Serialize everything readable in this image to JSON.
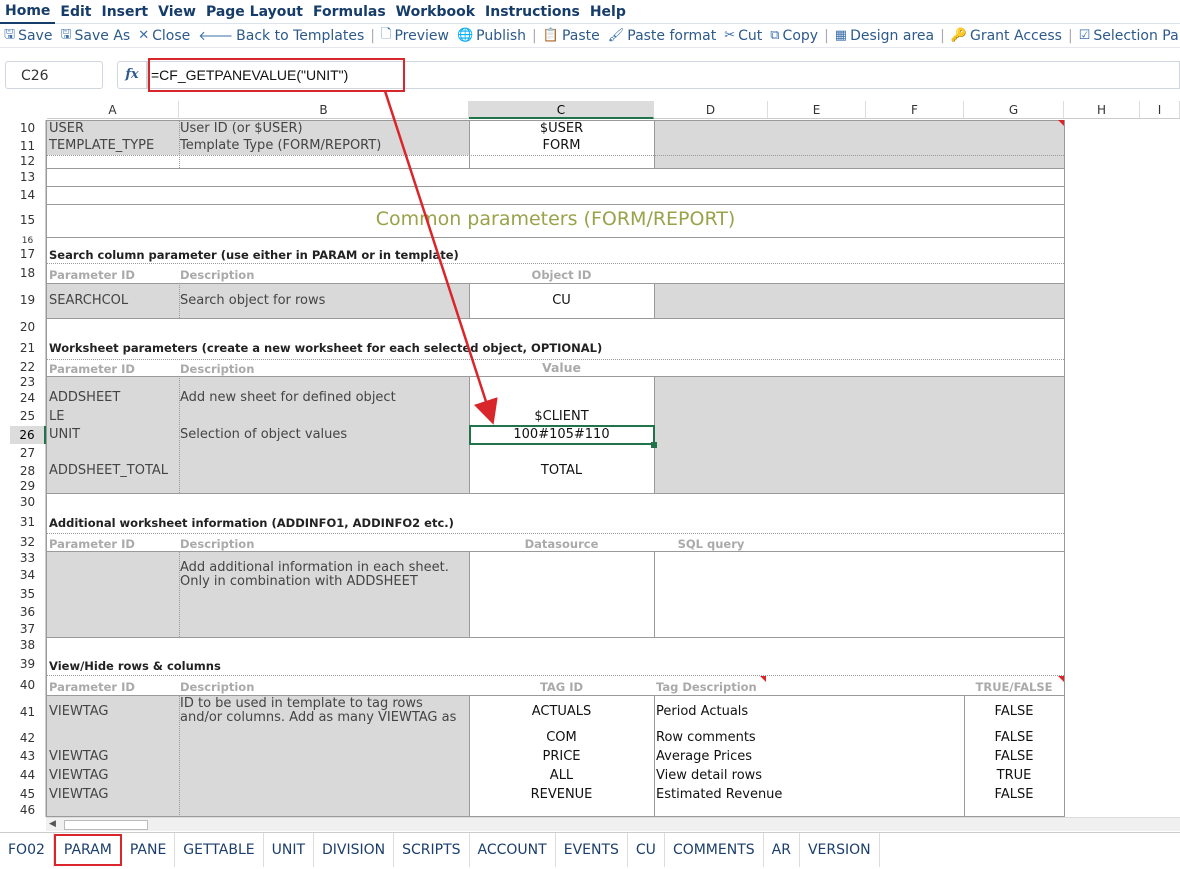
{
  "menu": [
    "Home",
    "Edit",
    "Insert",
    "View",
    "Page Layout",
    "Formulas",
    "Workbook",
    "Instructions",
    "Help"
  ],
  "toolbar": [
    {
      "icon": "save-icon",
      "glyph": "🖫",
      "label": "Save"
    },
    {
      "icon": "save-as-icon",
      "glyph": "🖫",
      "label": "Save As"
    },
    {
      "icon": "close-icon",
      "glyph": "✕",
      "label": "Close"
    },
    {
      "icon": "back-arrow-icon",
      "glyph": "🡐",
      "label": "Back to Templates"
    },
    {
      "sep": true
    },
    {
      "icon": "preview-icon",
      "glyph": "🗋",
      "label": "Preview"
    },
    {
      "icon": "globe-icon",
      "glyph": "🌐",
      "label": "Publish"
    },
    {
      "sep": true
    },
    {
      "icon": "paste-icon",
      "glyph": "📋",
      "label": "Paste"
    },
    {
      "icon": "paste-format-icon",
      "glyph": "🖌",
      "label": "Paste format"
    },
    {
      "icon": "cut-icon",
      "glyph": "✂",
      "label": "Cut"
    },
    {
      "icon": "copy-icon",
      "glyph": "⧉",
      "label": "Copy"
    },
    {
      "sep": true
    },
    {
      "icon": "design-area-icon",
      "glyph": "▦",
      "label": "Design area"
    },
    {
      "sep": true
    },
    {
      "icon": "key-icon",
      "glyph": "🔑",
      "label": "Grant Access"
    },
    {
      "sep": true
    },
    {
      "icon": "selection-pane-icon",
      "glyph": "☑",
      "label": "Selection Pa"
    }
  ],
  "formula_bar": {
    "cell_ref": "C26",
    "fx": "fx",
    "formula": "=CF_GETPANEVALUE(\"UNIT\")"
  },
  "columns": [
    "A",
    "B",
    "C",
    "D",
    "E",
    "F",
    "G",
    "H",
    "I"
  ],
  "rows": [
    "10",
    "11",
    "12",
    "13",
    "14",
    "15",
    "16",
    "17",
    "18",
    "19",
    "20",
    "21",
    "22",
    "23",
    "24",
    "25",
    "26",
    "27",
    "28",
    "29",
    "30",
    "31",
    "32",
    "33",
    "34",
    "35",
    "36",
    "37",
    "38",
    "39",
    "40",
    "41",
    "42",
    "43",
    "44",
    "45",
    "46"
  ],
  "sheet": {
    "r10a": "USER",
    "r10b": "User ID (or $USER)",
    "r10c": "$USER",
    "r11a": "TEMPLATE_TYPE",
    "r11b": "Template Type (FORM/REPORT)",
    "r11c": "FORM",
    "title15": "Common parameters (FORM/REPORT)",
    "sec17": "Search column parameter (use either in PARAM or in template)",
    "h18a": "Parameter ID",
    "h18b": "Description",
    "h18c": "Object ID",
    "r19a": "SEARCHCOL",
    "r19b": "Search object for rows",
    "r19c": "CU",
    "sec21": "Worksheet parameters (create a new worksheet for each selected object, OPTIONAL)",
    "h22a": "Parameter ID",
    "h22b": "Description",
    "h22c": "Value",
    "r24a": "ADDSHEET",
    "r24b": "Add new sheet for defined object",
    "r25a": "LE",
    "r25c": "$CLIENT",
    "r26a": "UNIT",
    "r26b": "Selection of object values",
    "r26c": "100#105#110",
    "r28a": "ADDSHEET_TOTAL",
    "r28c": "TOTAL",
    "sec31": "Additional worksheet information (ADDINFO1, ADDINFO2 etc.)",
    "h32a": "Parameter ID",
    "h32b": "Description",
    "h32c": "Datasource",
    "h32d": "SQL query",
    "r33b": "Add additional information in each sheet.",
    "r34b": "Only in combination with ADDSHEET",
    "sec39": "View/Hide rows & columns",
    "h40a": "Parameter ID",
    "h40b": "Description",
    "h40c": "TAG ID",
    "h40d": "Tag Description",
    "h40g": "TRUE/FALSE",
    "r41a": "VIEWTAG",
    "r41b1": "ID to be used in template to tag rows",
    "r41b2": "and/or columns. Add as many VIEWTAG as",
    "r41c": "ACTUALS",
    "r41d": "Period Actuals",
    "r41g": "FALSE",
    "r42c": "COM",
    "r42d": "Row comments",
    "r42g": "FALSE",
    "r43a": "VIEWTAG",
    "r43c": "PRICE",
    "r43d": "Average Prices",
    "r43g": "FALSE",
    "r44a": "VIEWTAG",
    "r44c": "ALL",
    "r44d": "View detail rows",
    "r44g": "TRUE",
    "r45a": "VIEWTAG",
    "r45c": "REVENUE",
    "r45d": "Estimated Revenue",
    "r45g": "FALSE"
  },
  "tabs": [
    "FO02",
    "PARAM",
    "PANE",
    "GETTABLE",
    "UNIT",
    "DIVISION",
    "SCRIPTS",
    "ACCOUNT",
    "EVENTS",
    "CU",
    "COMMENTS",
    "AR",
    "VERSION"
  ],
  "active_tab": "PARAM",
  "colors": {
    "accent": "#163c6a",
    "highlight": "#d9262b",
    "title": "#9aa24a",
    "selection": "#21734a"
  }
}
